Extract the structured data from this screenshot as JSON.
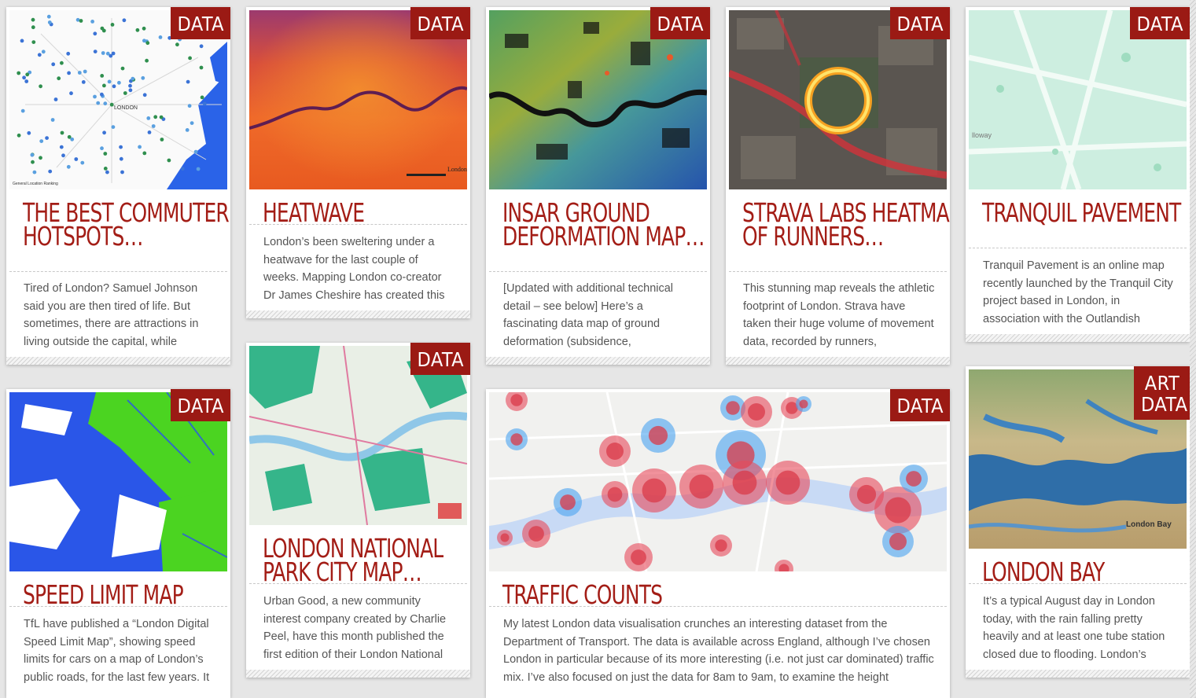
{
  "cards": [
    {
      "badge": "DATA",
      "title": "THE BEST COMMUTER HOTSPOTS…",
      "excerpt": "Tired of London? Samuel Johnson said you are then tired of life. But sometimes, there are attractions in living outside the capital, while",
      "image": "commuter-map"
    },
    {
      "badge": "DATA",
      "title": "HEATWAVE",
      "excerpt": "London’s been sweltering under a heatwave for the last couple of weeks. Mapping London co-creator Dr James Cheshire has created this",
      "image": "heat-map"
    },
    {
      "badge": "DATA",
      "title": "INSAR GROUND DEFORMATION MAP…",
      "excerpt": "[Updated with additional technical detail – see below] Here’s a fascinating data map of ground deformation (subsidence,",
      "image": "insar-map"
    },
    {
      "badge": "DATA",
      "title": "STRAVA LABS HEATMAP OF RUNNERS…",
      "excerpt": "This stunning map reveals the athletic footprint of London. Strava have taken their huge volume of movement data, recorded by runners,",
      "image": "strava-map"
    },
    {
      "badge": "DATA",
      "title": "TRANQUIL PAVEMENT",
      "excerpt": "Tranquil Pavement is an online map recently launched by the Tranquil City project based in London, in association with the Outlandish",
      "image": "tranquil-map"
    },
    {
      "badge": "DATA",
      "title": "SPEED LIMIT MAP",
      "excerpt": "TfL have published a “London Digital Speed Limit Map”, showing speed limits for cars on a map of London’s public roads, for the last few years. It",
      "image": "speed-map"
    },
    {
      "badge": "DATA",
      "title": "LONDON NATIONAL PARK CITY MAP…",
      "excerpt": "Urban Good, a new community interest company created by Charlie Peel, have this month published the first edition of their London National",
      "image": "park-map"
    },
    {
      "badge": "DATA",
      "title": "TRAFFIC COUNTS",
      "excerpt": "My latest London data visualisation crunches an interesting dataset from the Department of Transport. The data is available across England, although I’ve chosen London in particular because of its more interesting (i.e. not just car dominated) traffic mix. I’ve also focused on just the data for 8am to 9am, to examine the height",
      "image": "traffic-map"
    },
    {
      "badge": "ART DATA",
      "title": "LONDON BAY",
      "excerpt": "It’s a typical August day in London today, with the rain falling pretty heavily and at least one tube station closed due to flooding. London’s",
      "image": "bay-map"
    }
  ],
  "map_labels": {
    "commuter_center": "LONDON",
    "commuter_credit": "General Location Ranking",
    "heat_corner": "London",
    "bay_label": "London Bay",
    "tranquil_street": "lloway"
  },
  "colors": {
    "accent": "#a31d16",
    "badge": "#9b1a14",
    "background": "#e6e6e6"
  }
}
